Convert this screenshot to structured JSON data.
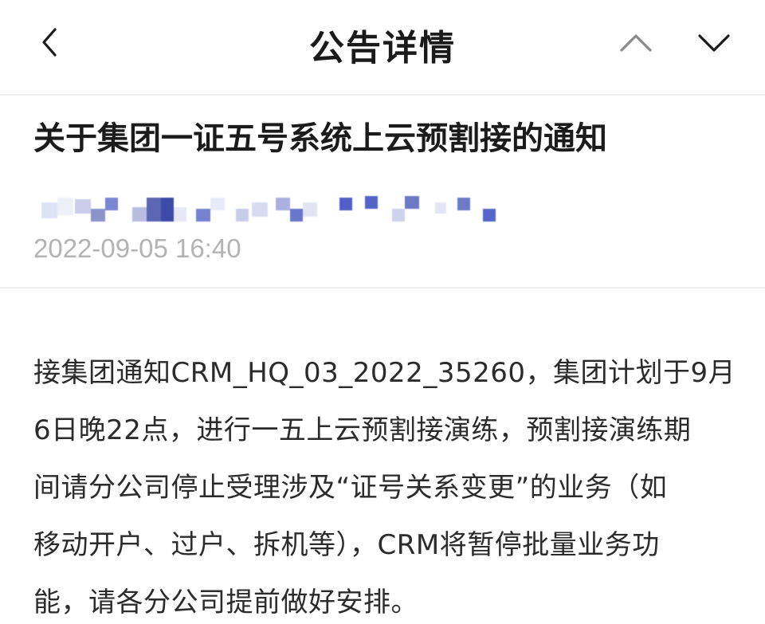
{
  "header": {
    "title": "公告详情",
    "back_icon": "chevron-left-icon",
    "prev_icon": "chevron-up-icon",
    "next_icon": "chevron-down-icon"
  },
  "article": {
    "title": "关于集团一证五号系统上云预割接的通知",
    "publish_time": "2022-09-05 16:40",
    "body_lines": [
      "接集团通知CRM_HQ_03_2022_35260，集团计划于9月",
      "6日晚22点，进行一五上云预割接演练，预割接演练期",
      "间请分公司停止受理涉及“证号关系变更”的业务（如",
      "移动开户、过户、拆机等），CRM将暂停批量业务功",
      "能，请各分公司提前做好安排。"
    ]
  },
  "colors": {
    "title_text": "#1b1b1b",
    "timestamp": "#b3b3b3",
    "divider": "#eeeeee",
    "blur_blue": "#5a6bd6"
  }
}
